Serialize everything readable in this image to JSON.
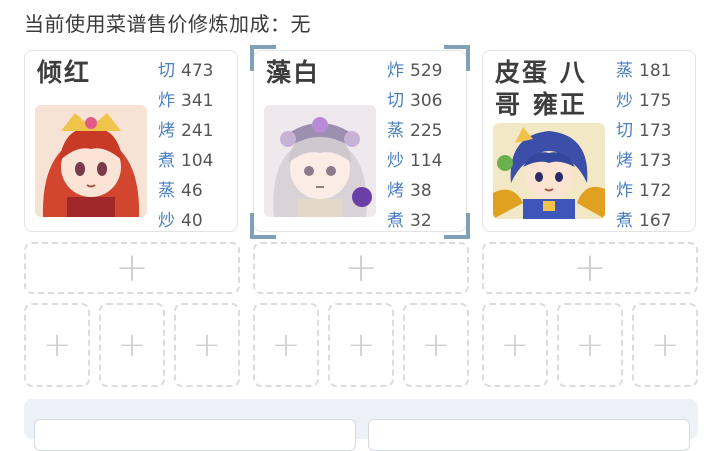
{
  "bonus_label": "当前使用菜谱售价修炼加成：无",
  "chefs": [
    {
      "name": "倾红",
      "stats": [
        {
          "skill": "切",
          "value": "473"
        },
        {
          "skill": "炸",
          "value": "341"
        },
        {
          "skill": "烤",
          "value": "241"
        },
        {
          "skill": "煮",
          "value": "104"
        },
        {
          "skill": "蒸",
          "value": "46"
        },
        {
          "skill": "炒",
          "value": "40"
        }
      ]
    },
    {
      "name": "藻白",
      "stats": [
        {
          "skill": "炸",
          "value": "529"
        },
        {
          "skill": "切",
          "value": "306"
        },
        {
          "skill": "蒸",
          "value": "225"
        },
        {
          "skill": "炒",
          "value": "114"
        },
        {
          "skill": "烤",
          "value": "38"
        },
        {
          "skill": "煮",
          "value": "32"
        }
      ]
    },
    {
      "name": "皮蛋 八哥 雍正",
      "stats": [
        {
          "skill": "蒸",
          "value": "181"
        },
        {
          "skill": "炒",
          "value": "175"
        },
        {
          "skill": "切",
          "value": "173"
        },
        {
          "skill": "烤",
          "value": "173"
        },
        {
          "skill": "炸",
          "value": "172"
        },
        {
          "skill": "煮",
          "value": "167"
        }
      ]
    }
  ],
  "plus_glyph": "+"
}
